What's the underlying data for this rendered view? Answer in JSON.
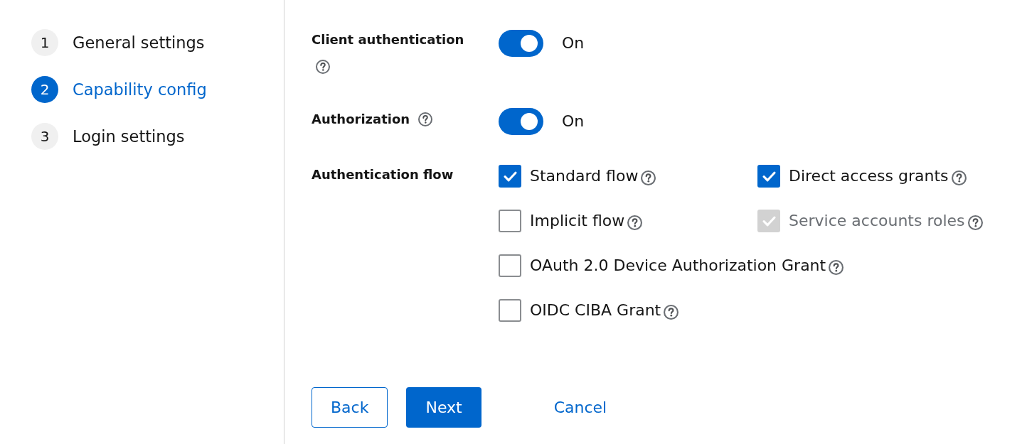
{
  "wizard_nav": {
    "steps": [
      {
        "number": "1",
        "label": "General settings",
        "selected": false
      },
      {
        "number": "2",
        "label": "Capability config",
        "selected": true
      },
      {
        "number": "3",
        "label": "Login settings",
        "selected": false
      }
    ]
  },
  "form": {
    "fields": [
      {
        "kind": "switch",
        "label": "Client authentication",
        "help_icon": true,
        "on": true,
        "state_text": "On"
      },
      {
        "kind": "switch",
        "label": "Authorization",
        "help_icon": true,
        "on": true,
        "state_text": "On"
      },
      {
        "kind": "checkbox_group",
        "label": "Authentication flow",
        "help_icon": false,
        "options": [
          {
            "label": "Standard flow",
            "checked": true,
            "disabled": false
          },
          {
            "label": "Direct access grants",
            "checked": true,
            "disabled": false
          },
          {
            "label": "Implicit flow",
            "checked": false,
            "disabled": false
          },
          {
            "label": "Service accounts roles",
            "checked": true,
            "disabled": true
          },
          {
            "label": "OAuth 2.0 Device Authorization Grant",
            "checked": false,
            "disabled": false
          },
          {
            "label": "OIDC CIBA Grant",
            "checked": false,
            "disabled": false
          }
        ]
      }
    ]
  },
  "footer": {
    "buttons": [
      {
        "kind": "secondary",
        "label": "Back"
      },
      {
        "kind": "primary",
        "label": "Next"
      },
      {
        "kind": "link",
        "label": "Cancel"
      }
    ]
  }
}
